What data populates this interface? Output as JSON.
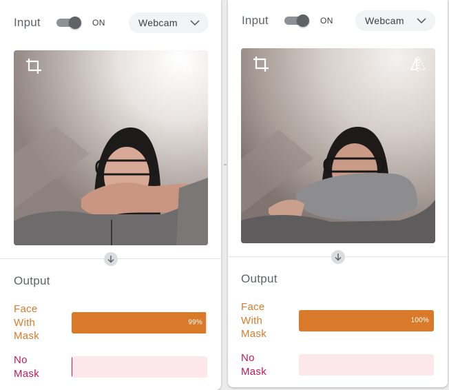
{
  "colors": {
    "orange": "#d97a2b",
    "orange_track": "#fbe9e7",
    "pink_text": "#c2185b",
    "pink_track": "#fce8ea",
    "toggle_track": "#8e9297",
    "toggle_knob": "#5f6368",
    "chip_bg": "#f1f3f4"
  },
  "panels": [
    {
      "input_label": "Input",
      "toggle_state": "ON",
      "toggle_on": true,
      "source": "Webcam",
      "crop_icon": "crop-icon",
      "mirror_icon": "mirror-icon",
      "output_label": "Output",
      "results": [
        {
          "label_line1": "Face",
          "label_line2": "With",
          "label_line3": "Mask",
          "pct_text": "99%",
          "confidence": 0.99,
          "color_key": "orange"
        },
        {
          "label_line1": "No",
          "label_line2": "Mask",
          "label_line3": "",
          "pct_text": "",
          "confidence": 0.005,
          "color_key": "pink"
        }
      ]
    },
    {
      "input_label": "Input",
      "toggle_state": "ON",
      "toggle_on": true,
      "source": "Webcam",
      "crop_icon": "crop-icon",
      "mirror_icon": "mirror-icon",
      "output_label": "Output",
      "results": [
        {
          "label_line1": "Face",
          "label_line2": "With",
          "label_line3": "Mask",
          "pct_text": "100%",
          "confidence": 1.0,
          "color_key": "orange"
        },
        {
          "label_line1": "No",
          "label_line2": "Mask",
          "label_line3": "",
          "pct_text": "",
          "confidence": 0.0,
          "color_key": "pink"
        }
      ]
    }
  ]
}
